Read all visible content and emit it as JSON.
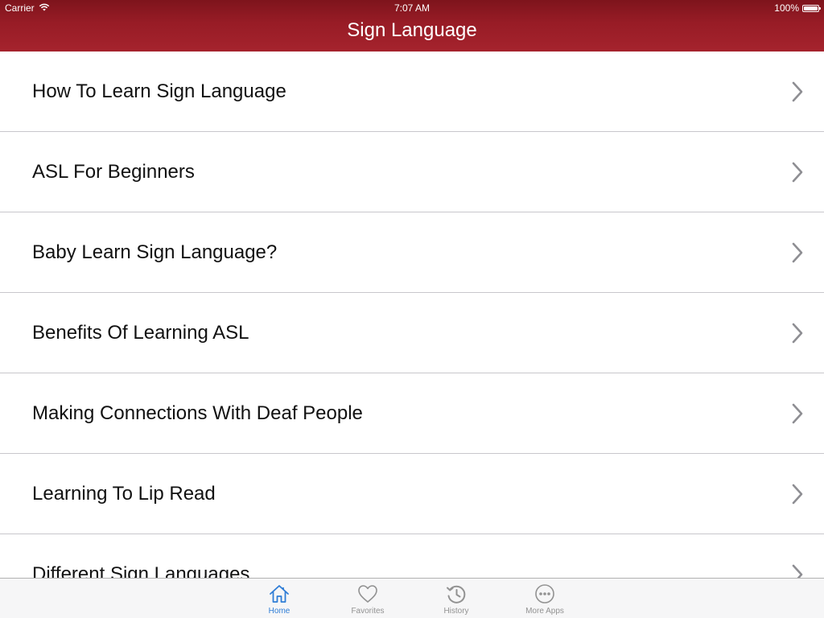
{
  "status_bar": {
    "carrier": "Carrier",
    "time": "7:07 AM",
    "battery_text": "100%",
    "battery_level": 1.0
  },
  "nav": {
    "title": "Sign Language"
  },
  "list": {
    "items": [
      {
        "label": "How To Learn Sign Language"
      },
      {
        "label": "ASL For Beginners"
      },
      {
        "label": "Baby Learn Sign Language?"
      },
      {
        "label": "Benefits Of Learning ASL"
      },
      {
        "label": "Making Connections With Deaf People"
      },
      {
        "label": "Learning To Lip Read"
      },
      {
        "label": "Different Sign Languages"
      }
    ]
  },
  "tabbar": {
    "tabs": [
      {
        "label": "Home",
        "icon": "home-icon",
        "active": true
      },
      {
        "label": "Favorites",
        "icon": "heart-icon",
        "active": false
      },
      {
        "label": "History",
        "icon": "history-icon",
        "active": false
      },
      {
        "label": "More Apps",
        "icon": "more-icon",
        "active": false
      }
    ]
  },
  "colors": {
    "nav_bar": "#981c26",
    "active_tab": "#2f7dd6",
    "inactive_tab": "#929292",
    "separator": "#c8c7cc",
    "chevron": "#8e8e93"
  }
}
